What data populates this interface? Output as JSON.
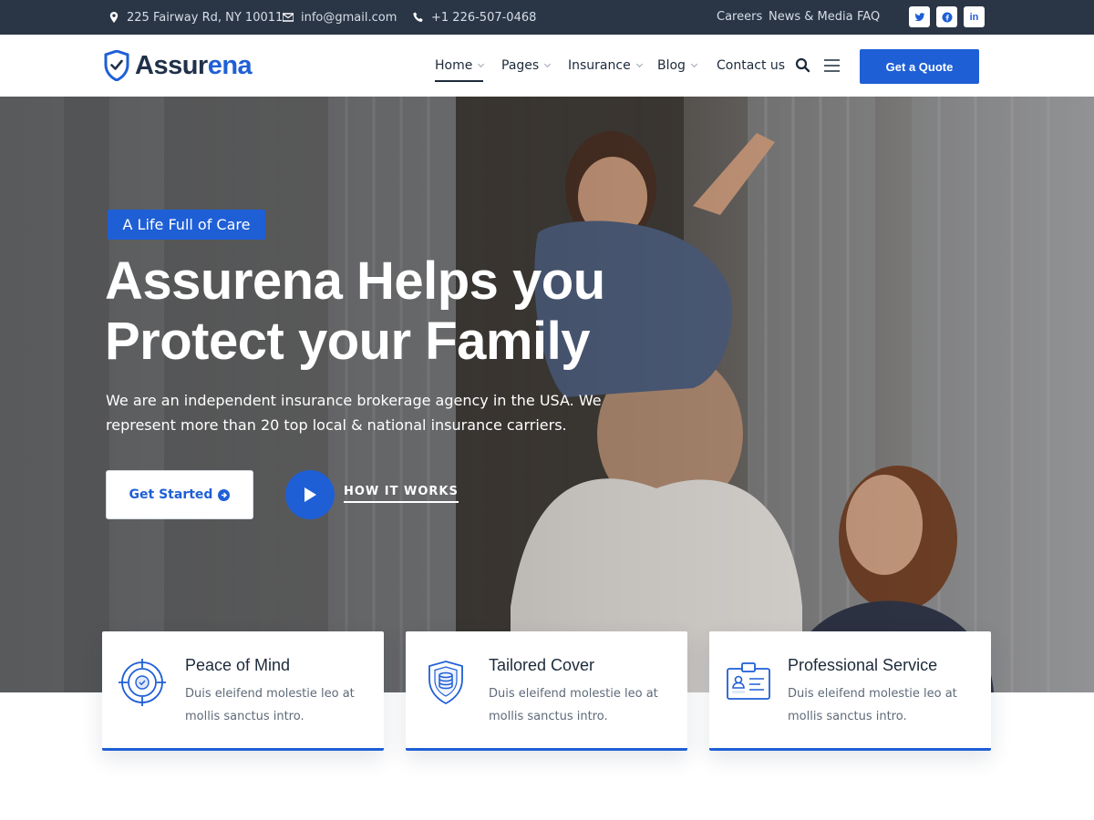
{
  "topbar": {
    "address": "225 Fairway Rd, NY 10011",
    "email": "info@gmail.com",
    "phone": "+1 226-507-0468",
    "links": [
      "Careers",
      "News & Media",
      "FAQ"
    ],
    "social": [
      "twitter-icon",
      "facebook-icon",
      "linkedin-icon"
    ]
  },
  "header": {
    "logo_part1": "Assur",
    "logo_part2": "ena",
    "nav": [
      {
        "label": "Home",
        "dropdown": true,
        "active": true
      },
      {
        "label": "Pages",
        "dropdown": true
      },
      {
        "label": "Insurance",
        "dropdown": true
      },
      {
        "label": "Blog",
        "dropdown": true
      },
      {
        "label": "Contact us",
        "dropdown": false
      }
    ],
    "quote_label": "Get a Quote"
  },
  "hero": {
    "tag": "A Life Full of Care",
    "title_line1": "Assurena Helps you",
    "title_line2": "Protect your Family",
    "description": "We are an independent insurance brokerage agency in the USA. We represent more than 20 top local & national insurance carriers.",
    "cta_label": "Get Started",
    "video_label": "HOW IT WORKS"
  },
  "features": [
    {
      "title": "Peace of Mind",
      "text": "Duis eleifend molestie leo at mollis sanctus intro.",
      "icon": "target-shield-icon"
    },
    {
      "title": "Tailored Cover",
      "text": "Duis eleifend molestie leo at mollis sanctus intro.",
      "icon": "shield-coins-icon"
    },
    {
      "title": "Professional Service",
      "text": "Duis eleifend molestie leo at mollis sanctus intro.",
      "icon": "id-badge-icon"
    }
  ],
  "colors": {
    "primary": "#1f5fd6",
    "topbar_bg": "#2a3646",
    "heading": "#1c2a3a"
  }
}
